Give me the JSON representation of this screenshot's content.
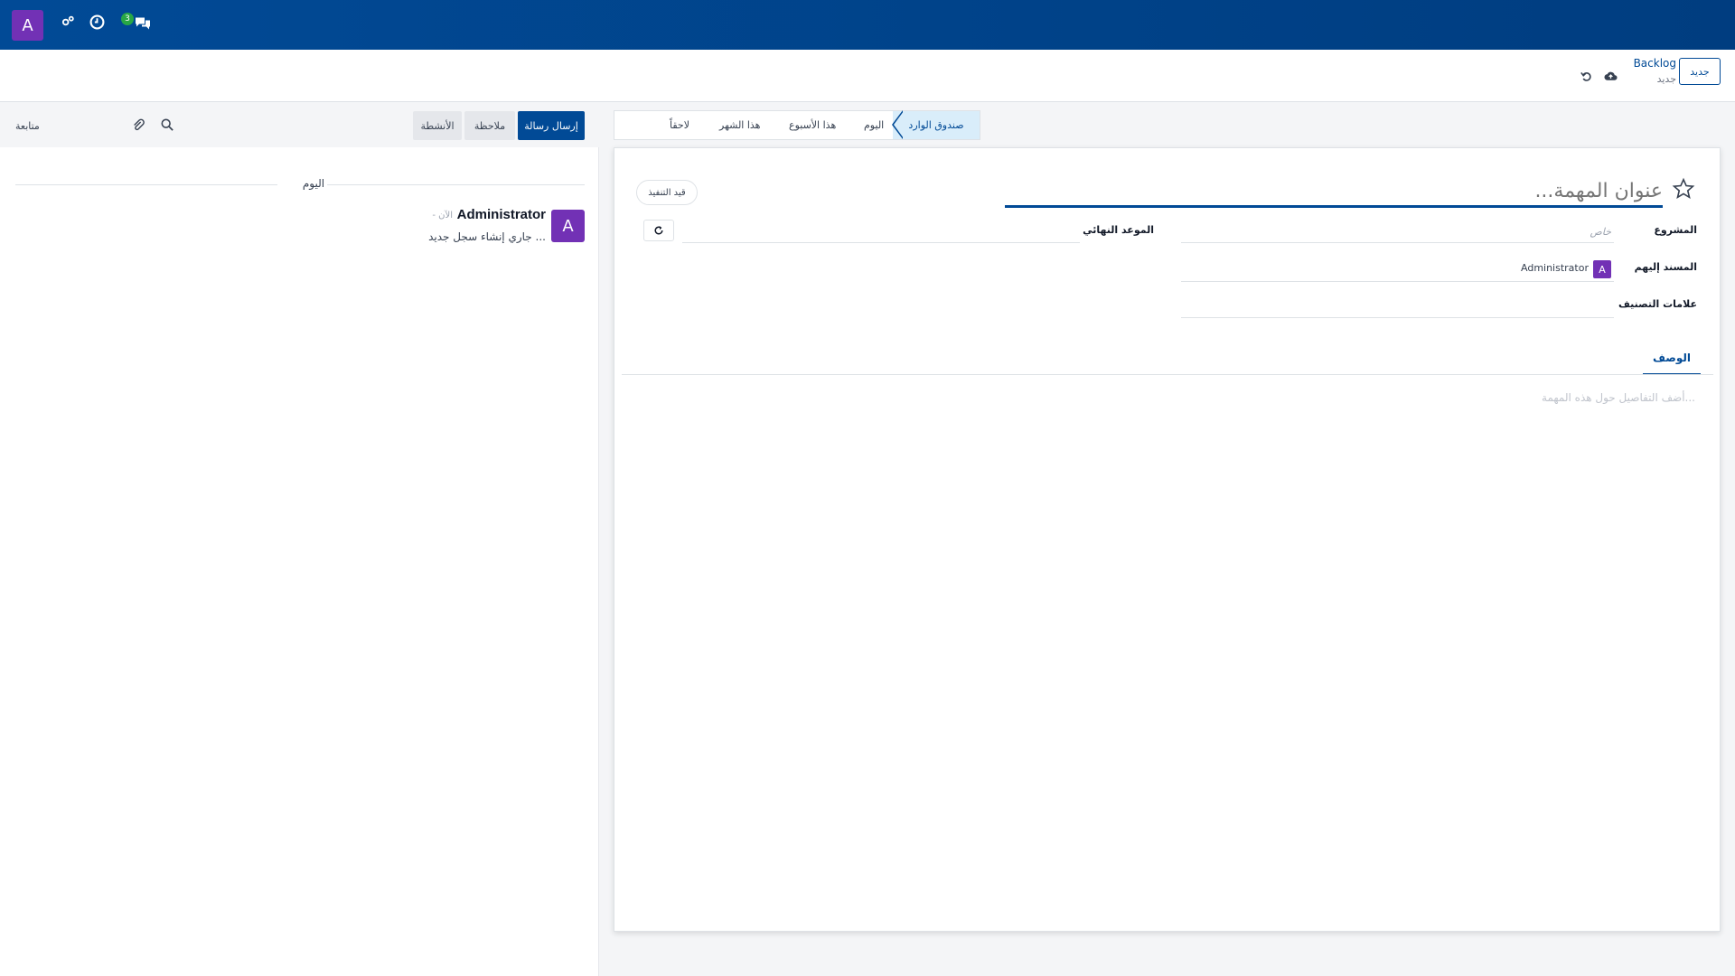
{
  "navbar": {
    "avatar_letter": "A",
    "message_count": "3"
  },
  "control_panel": {
    "new_button": "جديد",
    "breadcrumb": "Backlog",
    "record_status": "جديد"
  },
  "chatter": {
    "send_message": "إرسال رسالة",
    "log_note": "ملاحظة",
    "activities": "الأنشطة",
    "follow": "متابعة",
    "day_label": "اليوم",
    "message": {
      "avatar_letter": "A",
      "author": "Administrator",
      "time": "- الآن",
      "body": "جاري إنشاء سجل جديد ..."
    }
  },
  "stages": {
    "active": "صندوق الوارد",
    "today": "اليوم",
    "this_week": "هذا الأسبوع",
    "this_month": "هذا الشهر",
    "later": "لاحقاً"
  },
  "form": {
    "title_placeholder": "عنوان المهمة...",
    "status": "قيد التنفيذ",
    "project_label": "المشروع",
    "project_placeholder": "خاص",
    "deadline_label": "الموعد النهائي",
    "assignees_label": "المسند إليهم",
    "assignee_letter": "A",
    "assignee_name": "Administrator",
    "tags_label": "علامات التصنيف",
    "tab_description": "الوصف",
    "description_placeholder": "أضف التفاصيل حول هذه المهمة..."
  },
  "colors": {
    "brand": "#014a96",
    "avatar": "#7231b5",
    "badge": "#28a745"
  }
}
